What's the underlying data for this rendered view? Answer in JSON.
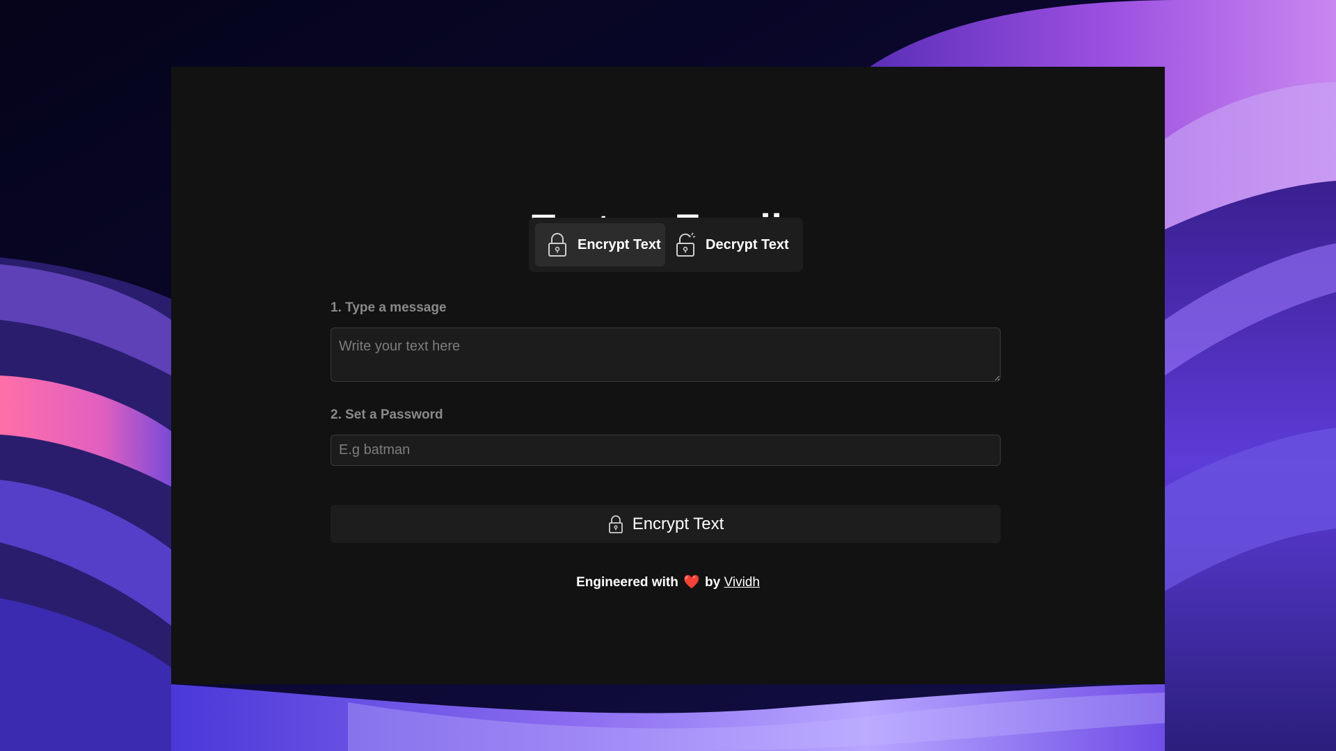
{
  "app": {
    "title_left": "Text",
    "title_arrow": "→",
    "title_right": "Emojis"
  },
  "modes": {
    "encrypt_label": "Encrypt Text",
    "decrypt_label": "Decrypt Text",
    "active": "encrypt",
    "encrypt_icon": "lock-icon",
    "decrypt_icon": "unlock-icon"
  },
  "form": {
    "message_label": "1. Type a message",
    "message_placeholder": "Write your text here",
    "message_value": "",
    "password_label": "2. Set a Password",
    "password_placeholder": "E.g batman",
    "password_value": "",
    "submit_label": "Encrypt Text",
    "submit_icon": "lock-icon"
  },
  "footer": {
    "prefix": "Engineered with",
    "heart": "❤️",
    "by": "by",
    "author": "Vividh"
  },
  "colors": {
    "panel_bg": "#121212",
    "control_bg": "#1d1d1d",
    "active_tab_bg": "#2c2c2c",
    "label_text": "#8a8a8a",
    "text": "#ffffff",
    "heart": "#e0242e"
  }
}
